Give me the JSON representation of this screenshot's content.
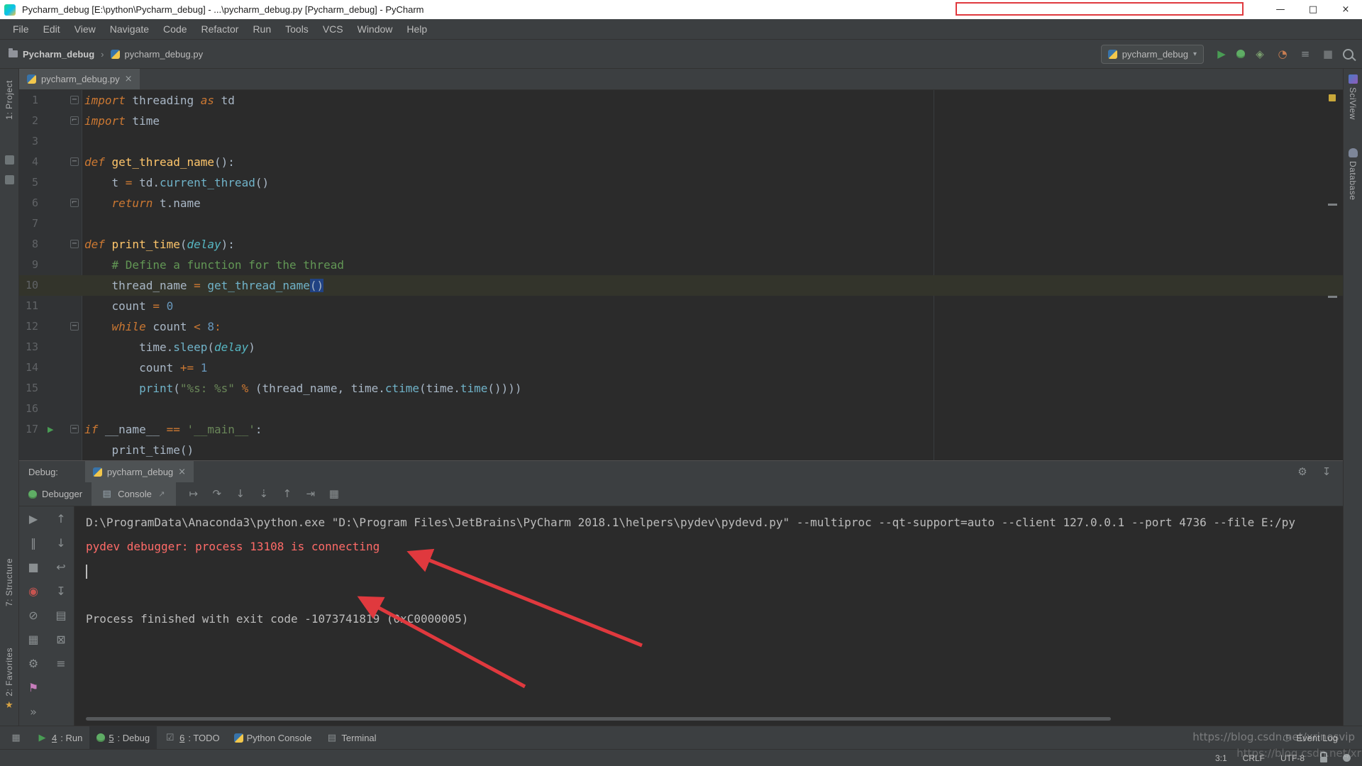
{
  "colors": {
    "editor_bg": "#2b2b2b",
    "panel_bg": "#3c3f41",
    "annotation_red": "#e0393e",
    "error_text_red": "#ff6b68",
    "selection_blue": "#214283",
    "run_green": "#499C54",
    "caret_line": "#33342b"
  },
  "title_bar": {
    "title": "Pycharm_debug [E:\\python\\Pycharm_debug] - ...\\pycharm_debug.py [Pycharm_debug] - PyCharm",
    "controls": [
      {
        "name": "minimize-button",
        "glyph": "—"
      },
      {
        "name": "maximize-button",
        "glyph": "□"
      },
      {
        "name": "close-button",
        "glyph": "×"
      }
    ]
  },
  "menu_bar": {
    "items": [
      "File",
      "Edit",
      "View",
      "Navigate",
      "Code",
      "Refactor",
      "Run",
      "Tools",
      "VCS",
      "Window",
      "Help"
    ]
  },
  "nav_bar": {
    "breadcrumbs": [
      {
        "label": "Pycharm_debug"
      },
      {
        "label": "pycharm_debug.py"
      }
    ],
    "separator": "›",
    "run_config": {
      "label": "pycharm_debug",
      "dropdown": "▾"
    },
    "icons": [
      {
        "name": "run-icon",
        "glyph": "▶",
        "color": "#499C54"
      },
      {
        "name": "debug-icon",
        "glyph": "bug"
      },
      {
        "name": "coverage-icon",
        "glyph": "◈",
        "color": "#7a9e6e"
      },
      {
        "name": "profiler-icon",
        "glyph": "◔",
        "color": "#c77d52"
      },
      {
        "name": "run-with-console-icon",
        "glyph": "≡",
        "color": "#8a8f91"
      },
      {
        "name": "stop-icon",
        "glyph": "■",
        "color": "#6e7274"
      },
      {
        "name": "search-everywhere-icon",
        "glyph": "css-search"
      }
    ]
  },
  "tool_strips": {
    "left": [
      {
        "label": "1: Project"
      },
      {
        "label": "7: Structure"
      },
      {
        "label": "2: Favorites"
      }
    ],
    "right": [
      {
        "label": "SciView"
      },
      {
        "label": "Database"
      }
    ]
  },
  "editor": {
    "tab": {
      "label": "pycharm_debug.py",
      "close": "×"
    },
    "lines": [
      {
        "n": "1",
        "fold": "open",
        "tokens": [
          {
            "t": "import",
            "c": "kw"
          },
          {
            "t": " threading ",
            "c": "tx"
          },
          {
            "t": "as",
            "c": "kw"
          },
          {
            "t": " td",
            "c": "tx"
          }
        ]
      },
      {
        "n": "2",
        "fold": "close",
        "tokens": [
          {
            "t": "import",
            "c": "kw"
          },
          {
            "t": " time",
            "c": "tx"
          }
        ]
      },
      {
        "n": "3",
        "tokens": []
      },
      {
        "n": "4",
        "fold": "open",
        "tokens": [
          {
            "t": "def ",
            "c": "kw"
          },
          {
            "t": "get_thread_name",
            "c": "fd"
          },
          {
            "t": "():",
            "c": "tx"
          }
        ]
      },
      {
        "n": "5",
        "tokens": [
          {
            "t": "    t ",
            "c": "tx"
          },
          {
            "t": "=",
            "c": "op"
          },
          {
            "t": " td.",
            "c": "tx"
          },
          {
            "t": "current_thread",
            "c": "fc"
          },
          {
            "t": "()",
            "c": "tx"
          }
        ]
      },
      {
        "n": "6",
        "fold": "close",
        "tokens": [
          {
            "t": "    ",
            "c": "tx"
          },
          {
            "t": "return",
            "c": "kw"
          },
          {
            "t": " t.name",
            "c": "tx"
          }
        ]
      },
      {
        "n": "7",
        "tokens": []
      },
      {
        "n": "8",
        "fold": "open",
        "tokens": [
          {
            "t": "def ",
            "c": "kw"
          },
          {
            "t": "print_time",
            "c": "fd"
          },
          {
            "t": "(",
            "c": "tx"
          },
          {
            "t": "delay",
            "c": "pr"
          },
          {
            "t": "):",
            "c": "tx"
          }
        ]
      },
      {
        "n": "9",
        "tokens": [
          {
            "t": "    # Define a function for the thread",
            "c": "cm"
          }
        ]
      },
      {
        "n": "10",
        "current": true,
        "tokens": [
          {
            "t": "    thread_name ",
            "c": "tx"
          },
          {
            "t": "=",
            "c": "op"
          },
          {
            "t": " ",
            "c": "tx"
          },
          {
            "t": "get_thread_name",
            "c": "fc"
          },
          {
            "t": "()",
            "c": "sel"
          }
        ]
      },
      {
        "n": "11",
        "tokens": [
          {
            "t": "    count ",
            "c": "tx"
          },
          {
            "t": "=",
            "c": "op"
          },
          {
            "t": " ",
            "c": "tx"
          },
          {
            "t": "0",
            "c": "num"
          }
        ]
      },
      {
        "n": "12",
        "fold": "open",
        "tokens": [
          {
            "t": "    ",
            "c": "tx"
          },
          {
            "t": "while",
            "c": "kw"
          },
          {
            "t": " count ",
            "c": "tx"
          },
          {
            "t": "<",
            "c": "op"
          },
          {
            "t": " ",
            "c": "tx"
          },
          {
            "t": "8",
            "c": "num"
          },
          {
            "t": ":",
            "c": "op"
          }
        ]
      },
      {
        "n": "13",
        "tokens": [
          {
            "t": "        time.",
            "c": "tx"
          },
          {
            "t": "sleep",
            "c": "fc"
          },
          {
            "t": "(",
            "c": "tx"
          },
          {
            "t": "delay",
            "c": "pr"
          },
          {
            "t": ")",
            "c": "tx"
          }
        ]
      },
      {
        "n": "14",
        "tokens": [
          {
            "t": "        count ",
            "c": "tx"
          },
          {
            "t": "+=",
            "c": "op"
          },
          {
            "t": " ",
            "c": "tx"
          },
          {
            "t": "1",
            "c": "num"
          }
        ]
      },
      {
        "n": "15",
        "tokens": [
          {
            "t": "        ",
            "c": "tx"
          },
          {
            "t": "print",
            "c": "fc"
          },
          {
            "t": "(",
            "c": "tx"
          },
          {
            "t": "\"%s: %s\"",
            "c": "st"
          },
          {
            "t": " ",
            "c": "tx"
          },
          {
            "t": "%",
            "c": "op"
          },
          {
            "t": " (thread_name, time.",
            "c": "tx"
          },
          {
            "t": "ctime",
            "c": "fc"
          },
          {
            "t": "(time.",
            "c": "tx"
          },
          {
            "t": "time",
            "c": "fc"
          },
          {
            "t": "())))",
            "c": "tx"
          }
        ]
      },
      {
        "n": "16",
        "tokens": []
      },
      {
        "n": "17",
        "fold": "open",
        "run": true,
        "tokens": [
          {
            "t": "if",
            "c": "kw"
          },
          {
            "t": " __name__ ",
            "c": "tx"
          },
          {
            "t": "==",
            "c": "op"
          },
          {
            "t": " ",
            "c": "tx"
          },
          {
            "t": "'__main__'",
            "c": "st"
          },
          {
            "t": ":",
            "c": "tx"
          }
        ]
      },
      {
        "n": "",
        "tokens": [
          {
            "t": "    print_time()",
            "c": "tx"
          }
        ]
      }
    ]
  },
  "debug_panel": {
    "header_label": "Debug:",
    "session_tab": {
      "label": "pycharm_debug",
      "close": "×"
    },
    "tabs": [
      {
        "label": "Debugger",
        "icon": "bug"
      },
      {
        "label": "Console",
        "icon": "▤",
        "icon_color": "#9aa7b0",
        "active": true
      }
    ],
    "console_tab_arrow": "↗",
    "step_icons": [
      {
        "name": "show-execution-point-icon",
        "glyph": "↦"
      },
      {
        "name": "step-over-icon",
        "glyph": "↷"
      },
      {
        "name": "step-into-icon",
        "glyph": "↓"
      },
      {
        "name": "step-into-my-code-icon",
        "glyph": "⇣"
      },
      {
        "name": "step-out-icon",
        "glyph": "↑"
      },
      {
        "name": "run-to-cursor-icon",
        "glyph": "⇥"
      },
      {
        "name": "evaluate-expression-icon",
        "glyph": "▦"
      }
    ],
    "left_icons": [
      {
        "name": "resume-icon",
        "glyph": "▶",
        "color": "#8a8f91"
      },
      {
        "name": "pause-icon",
        "glyph": "‖",
        "color": "#8a8f91"
      },
      {
        "name": "stop-icon",
        "glyph": "■",
        "color": "#8a8f91"
      },
      {
        "name": "view-breakpoints-icon",
        "glyph": "◉",
        "color": "#c75450"
      },
      {
        "name": "mute-breakpoints-icon",
        "glyph": "⊘",
        "color": "#8a8f91"
      },
      {
        "name": "restore-layout-icon",
        "glyph": "▦",
        "color": "#8a8f91"
      },
      {
        "name": "settings-icon",
        "glyph": "⚙",
        "color": "#8a8f91"
      },
      {
        "name": "pin-icon",
        "glyph": "⚑",
        "color": "#c77dbb"
      },
      {
        "name": "more-icon",
        "glyph": "»",
        "color": "#8a8f91"
      }
    ],
    "console_icons": [
      {
        "name": "up-stack-icon",
        "glyph": "↑",
        "color": "#8a8f91"
      },
      {
        "name": "down-stack-icon",
        "glyph": "↓",
        "color": "#8a8f91"
      },
      {
        "name": "soft-wrap-icon",
        "glyph": "↩",
        "color": "#8a8f91"
      },
      {
        "name": "scroll-to-end-icon",
        "glyph": "↧",
        "color": "#8a8f91"
      },
      {
        "name": "print-icon",
        "glyph": "▤",
        "color": "#8a8f91"
      },
      {
        "name": "clear-all-icon",
        "glyph": "⊠",
        "color": "#8a8f91"
      },
      {
        "name": "console-history-icon",
        "glyph": "≡",
        "color": "#8a8f91"
      }
    ],
    "header_icons": [
      {
        "name": "settings-gear-icon",
        "glyph": "⚙",
        "color": "#8a8f91"
      },
      {
        "name": "hide-panel-icon",
        "glyph": "↧",
        "color": "#8a8f91"
      }
    ],
    "console": {
      "lines": [
        {
          "cls": "out",
          "text": "D:\\ProgramData\\Anaconda3\\python.exe \"D:\\Program Files\\JetBrains\\PyCharm 2018.1\\helpers\\pydev\\pydevd.py\" --multiproc --qt-support=auto --client 127.0.0.1 --port 4736 --file E:/py"
        },
        {
          "cls": "err",
          "text": "pydev debugger: process 13108 is connecting"
        },
        {
          "cls": "cursor",
          "text": ""
        },
        {
          "cls": "out",
          "text": ""
        },
        {
          "cls": "out",
          "text": "Process finished with exit code -1073741819 (0xC0000005)"
        }
      ]
    }
  },
  "tool_window_bar": {
    "left": [
      {
        "name": "tool-windows",
        "icon": "▦",
        "icon_color": "#8a8f91",
        "num": "",
        "label": ""
      },
      {
        "name": "run",
        "icon": "▶",
        "icon_color": "#499C54",
        "num": "4",
        "label": ": Run"
      },
      {
        "name": "debug",
        "icon": "bug",
        "num": "5",
        "label": ": Debug",
        "active": true
      },
      {
        "name": "todo",
        "icon": "☑",
        "icon_color": "#8a8f91",
        "num": "6",
        "label": ": TODO"
      },
      {
        "name": "python-console",
        "icon": "py",
        "num": "",
        "label": "Python Console"
      },
      {
        "name": "terminal",
        "icon": "▤",
        "icon_color": "#8a8f91",
        "num": "",
        "label": "Terminal"
      }
    ],
    "right": [
      {
        "name": "event-log",
        "icon": "◷",
        "icon_color": "#8a8f91",
        "label": "Event Log"
      }
    ]
  },
  "status_bar": {
    "position": "3:1",
    "line_separator": "CRLF",
    "encoding": "UTF-8"
  },
  "watermark": "https://blog.csdn.net/xrinosvip"
}
